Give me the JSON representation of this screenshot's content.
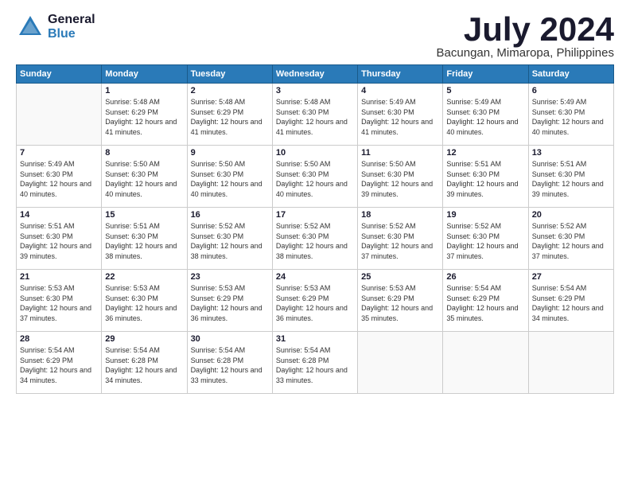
{
  "header": {
    "logo_general": "General",
    "logo_blue": "Blue",
    "month_title": "July 2024",
    "location": "Bacungan, Mimaropa, Philippines"
  },
  "weekdays": [
    "Sunday",
    "Monday",
    "Tuesday",
    "Wednesday",
    "Thursday",
    "Friday",
    "Saturday"
  ],
  "weeks": [
    [
      {
        "day": "",
        "sunrise": "",
        "sunset": "",
        "daylight": ""
      },
      {
        "day": "1",
        "sunrise": "Sunrise: 5:48 AM",
        "sunset": "Sunset: 6:29 PM",
        "daylight": "Daylight: 12 hours and 41 minutes."
      },
      {
        "day": "2",
        "sunrise": "Sunrise: 5:48 AM",
        "sunset": "Sunset: 6:29 PM",
        "daylight": "Daylight: 12 hours and 41 minutes."
      },
      {
        "day": "3",
        "sunrise": "Sunrise: 5:48 AM",
        "sunset": "Sunset: 6:30 PM",
        "daylight": "Daylight: 12 hours and 41 minutes."
      },
      {
        "day": "4",
        "sunrise": "Sunrise: 5:49 AM",
        "sunset": "Sunset: 6:30 PM",
        "daylight": "Daylight: 12 hours and 41 minutes."
      },
      {
        "day": "5",
        "sunrise": "Sunrise: 5:49 AM",
        "sunset": "Sunset: 6:30 PM",
        "daylight": "Daylight: 12 hours and 40 minutes."
      },
      {
        "day": "6",
        "sunrise": "Sunrise: 5:49 AM",
        "sunset": "Sunset: 6:30 PM",
        "daylight": "Daylight: 12 hours and 40 minutes."
      }
    ],
    [
      {
        "day": "7",
        "sunrise": "Sunrise: 5:49 AM",
        "sunset": "Sunset: 6:30 PM",
        "daylight": "Daylight: 12 hours and 40 minutes."
      },
      {
        "day": "8",
        "sunrise": "Sunrise: 5:50 AM",
        "sunset": "Sunset: 6:30 PM",
        "daylight": "Daylight: 12 hours and 40 minutes."
      },
      {
        "day": "9",
        "sunrise": "Sunrise: 5:50 AM",
        "sunset": "Sunset: 6:30 PM",
        "daylight": "Daylight: 12 hours and 40 minutes."
      },
      {
        "day": "10",
        "sunrise": "Sunrise: 5:50 AM",
        "sunset": "Sunset: 6:30 PM",
        "daylight": "Daylight: 12 hours and 40 minutes."
      },
      {
        "day": "11",
        "sunrise": "Sunrise: 5:50 AM",
        "sunset": "Sunset: 6:30 PM",
        "daylight": "Daylight: 12 hours and 39 minutes."
      },
      {
        "day": "12",
        "sunrise": "Sunrise: 5:51 AM",
        "sunset": "Sunset: 6:30 PM",
        "daylight": "Daylight: 12 hours and 39 minutes."
      },
      {
        "day": "13",
        "sunrise": "Sunrise: 5:51 AM",
        "sunset": "Sunset: 6:30 PM",
        "daylight": "Daylight: 12 hours and 39 minutes."
      }
    ],
    [
      {
        "day": "14",
        "sunrise": "Sunrise: 5:51 AM",
        "sunset": "Sunset: 6:30 PM",
        "daylight": "Daylight: 12 hours and 39 minutes."
      },
      {
        "day": "15",
        "sunrise": "Sunrise: 5:51 AM",
        "sunset": "Sunset: 6:30 PM",
        "daylight": "Daylight: 12 hours and 38 minutes."
      },
      {
        "day": "16",
        "sunrise": "Sunrise: 5:52 AM",
        "sunset": "Sunset: 6:30 PM",
        "daylight": "Daylight: 12 hours and 38 minutes."
      },
      {
        "day": "17",
        "sunrise": "Sunrise: 5:52 AM",
        "sunset": "Sunset: 6:30 PM",
        "daylight": "Daylight: 12 hours and 38 minutes."
      },
      {
        "day": "18",
        "sunrise": "Sunrise: 5:52 AM",
        "sunset": "Sunset: 6:30 PM",
        "daylight": "Daylight: 12 hours and 37 minutes."
      },
      {
        "day": "19",
        "sunrise": "Sunrise: 5:52 AM",
        "sunset": "Sunset: 6:30 PM",
        "daylight": "Daylight: 12 hours and 37 minutes."
      },
      {
        "day": "20",
        "sunrise": "Sunrise: 5:52 AM",
        "sunset": "Sunset: 6:30 PM",
        "daylight": "Daylight: 12 hours and 37 minutes."
      }
    ],
    [
      {
        "day": "21",
        "sunrise": "Sunrise: 5:53 AM",
        "sunset": "Sunset: 6:30 PM",
        "daylight": "Daylight: 12 hours and 37 minutes."
      },
      {
        "day": "22",
        "sunrise": "Sunrise: 5:53 AM",
        "sunset": "Sunset: 6:30 PM",
        "daylight": "Daylight: 12 hours and 36 minutes."
      },
      {
        "day": "23",
        "sunrise": "Sunrise: 5:53 AM",
        "sunset": "Sunset: 6:29 PM",
        "daylight": "Daylight: 12 hours and 36 minutes."
      },
      {
        "day": "24",
        "sunrise": "Sunrise: 5:53 AM",
        "sunset": "Sunset: 6:29 PM",
        "daylight": "Daylight: 12 hours and 36 minutes."
      },
      {
        "day": "25",
        "sunrise": "Sunrise: 5:53 AM",
        "sunset": "Sunset: 6:29 PM",
        "daylight": "Daylight: 12 hours and 35 minutes."
      },
      {
        "day": "26",
        "sunrise": "Sunrise: 5:54 AM",
        "sunset": "Sunset: 6:29 PM",
        "daylight": "Daylight: 12 hours and 35 minutes."
      },
      {
        "day": "27",
        "sunrise": "Sunrise: 5:54 AM",
        "sunset": "Sunset: 6:29 PM",
        "daylight": "Daylight: 12 hours and 34 minutes."
      }
    ],
    [
      {
        "day": "28",
        "sunrise": "Sunrise: 5:54 AM",
        "sunset": "Sunset: 6:29 PM",
        "daylight": "Daylight: 12 hours and 34 minutes."
      },
      {
        "day": "29",
        "sunrise": "Sunrise: 5:54 AM",
        "sunset": "Sunset: 6:28 PM",
        "daylight": "Daylight: 12 hours and 34 minutes."
      },
      {
        "day": "30",
        "sunrise": "Sunrise: 5:54 AM",
        "sunset": "Sunset: 6:28 PM",
        "daylight": "Daylight: 12 hours and 33 minutes."
      },
      {
        "day": "31",
        "sunrise": "Sunrise: 5:54 AM",
        "sunset": "Sunset: 6:28 PM",
        "daylight": "Daylight: 12 hours and 33 minutes."
      },
      {
        "day": "",
        "sunrise": "",
        "sunset": "",
        "daylight": ""
      },
      {
        "day": "",
        "sunrise": "",
        "sunset": "",
        "daylight": ""
      },
      {
        "day": "",
        "sunrise": "",
        "sunset": "",
        "daylight": ""
      }
    ]
  ]
}
